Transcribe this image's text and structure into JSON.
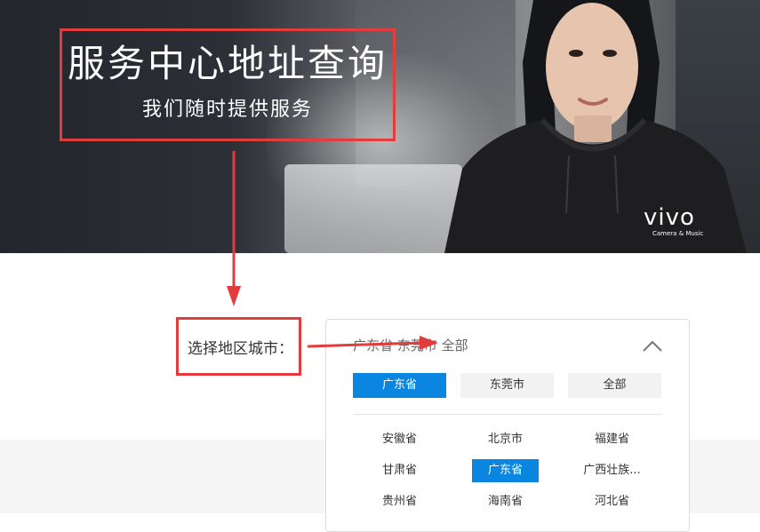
{
  "hero": {
    "title": "服务中心地址查询",
    "subtitle": "我们随时提供服务",
    "brand_logo": "vivo",
    "brand_tagline": "Camera & Music"
  },
  "selector": {
    "label": "选择地区城市：",
    "selected_path": "广东省 东莞市 全部",
    "expand_icon": "chevron-up-icon",
    "tabs": [
      {
        "label": "广东省",
        "active": true
      },
      {
        "label": "东莞市",
        "active": false
      },
      {
        "label": "全部",
        "active": false
      }
    ],
    "provinces": [
      {
        "label": "安徽省",
        "active": false
      },
      {
        "label": "北京市",
        "active": false
      },
      {
        "label": "福建省",
        "active": false
      },
      {
        "label": "甘肃省",
        "active": false
      },
      {
        "label": "广东省",
        "active": true
      },
      {
        "label": "广西壮族...",
        "active": false
      },
      {
        "label": "贵州省",
        "active": false
      },
      {
        "label": "海南省",
        "active": false
      },
      {
        "label": "河北省",
        "active": false
      }
    ]
  },
  "colors": {
    "accent": "#0a86e0",
    "annotation_red": "#e23c3c",
    "hoodie": "#1e1e20"
  }
}
